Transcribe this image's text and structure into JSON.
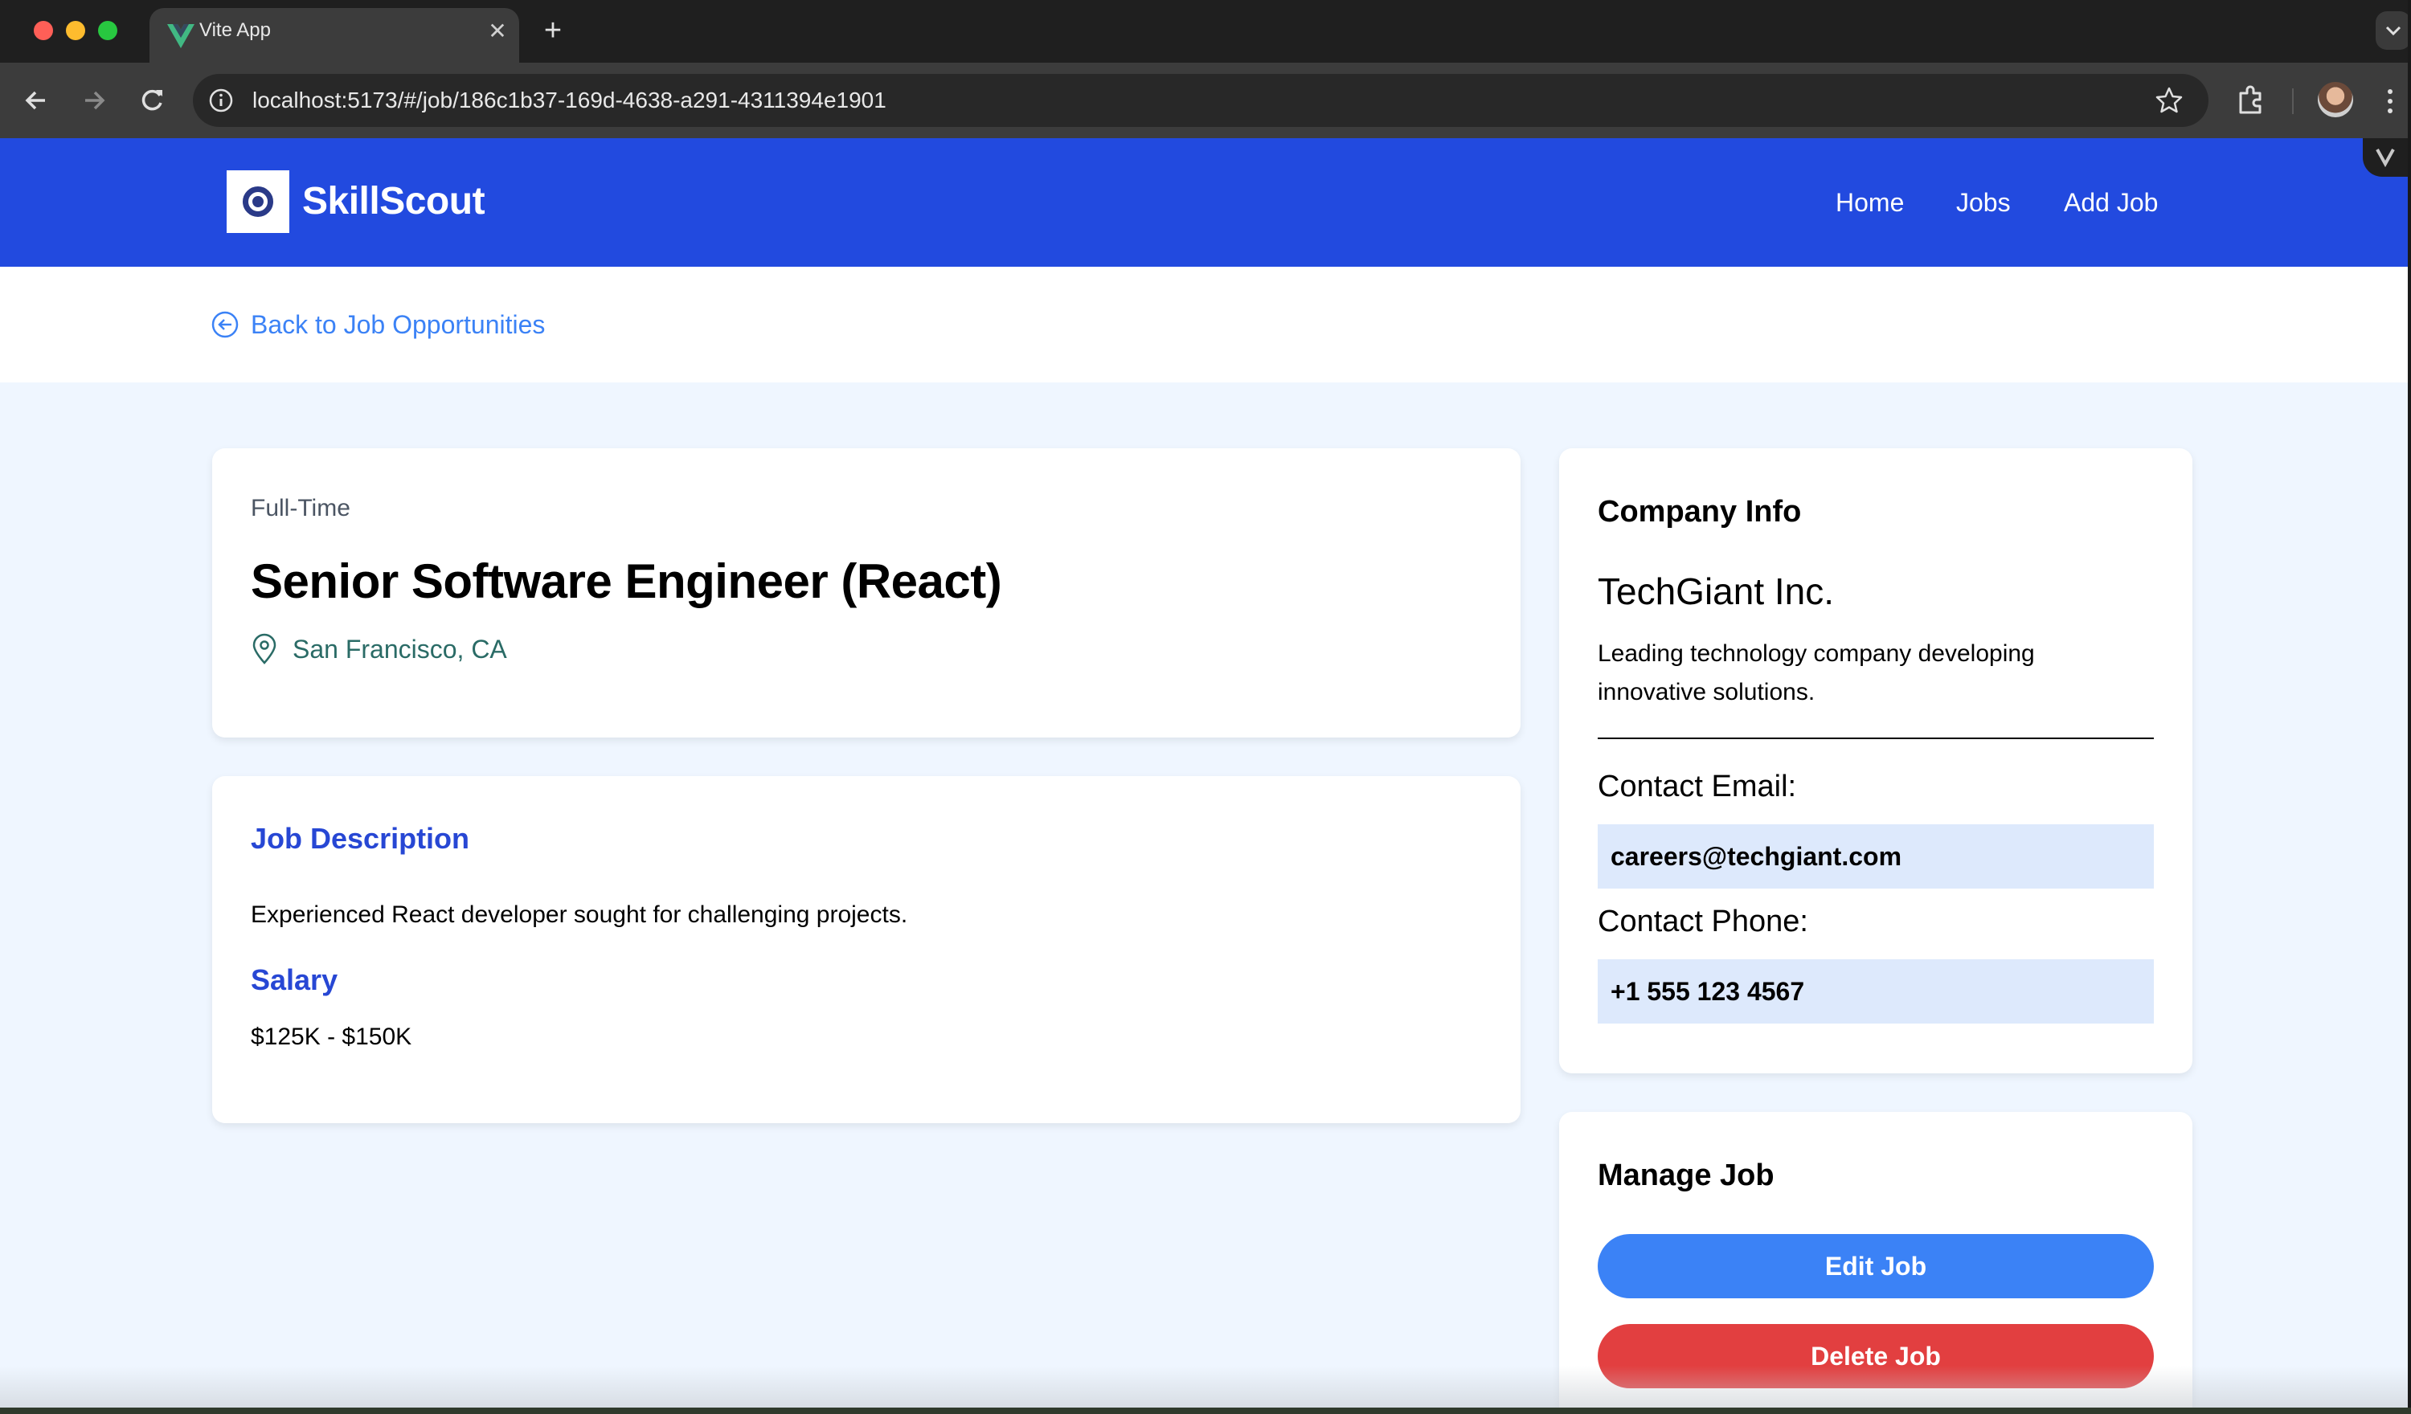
{
  "browser": {
    "tab_title": "Vite App",
    "url": "localhost:5173/#/job/186c1b37-169d-4638-a291-4311394e1901"
  },
  "app": {
    "brand": "SkillScout",
    "nav": [
      "Home",
      "Jobs",
      "Add Job"
    ]
  },
  "back_link": "Back to Job Opportunities",
  "job": {
    "type": "Full-Time",
    "title": "Senior Software Engineer (React)",
    "location": "San Francisco, CA",
    "description_heading": "Job Description",
    "description": "Experienced React developer sought for challenging projects.",
    "salary_heading": "Salary",
    "salary": "$125K - $150K"
  },
  "company": {
    "heading": "Company Info",
    "name": "TechGiant Inc.",
    "description": "Leading technology company developing innovative solutions.",
    "email_label": "Contact Email:",
    "email": "careers@techgiant.com",
    "phone_label": "Contact Phone:",
    "phone": "+1 555 123 4567"
  },
  "manage": {
    "heading": "Manage Job",
    "edit_label": "Edit Job",
    "delete_label": "Delete Job"
  },
  "colors": {
    "header_bg": "#224adf",
    "page_bg": "#eff6ff",
    "link_blue": "#3b82f6",
    "heading_blue": "#2747d4",
    "location_teal": "#2a6b66",
    "edit_button": "#3b82f6",
    "delete_button": "#e23f40",
    "contact_field_bg": "#dde9fc"
  },
  "icons": {
    "tab_favicon": "vue-logo-icon",
    "back": "arrow-left-circle-icon",
    "location": "map-pin-icon",
    "logo": "target-eye-icon"
  }
}
